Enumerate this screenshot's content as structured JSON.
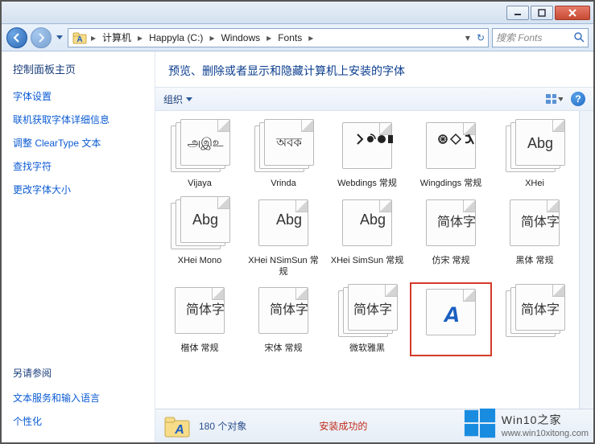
{
  "titlebar": {
    "min": "—",
    "max": "□",
    "close": "×"
  },
  "breadcrumb": {
    "segs": [
      "计算机",
      "Happyla (C:)",
      "Windows",
      "Fonts"
    ]
  },
  "search": {
    "placeholder": "搜索 Fonts"
  },
  "sidebar": {
    "heading": "控制面板主页",
    "links": [
      "字体设置",
      "联机获取字体详细信息",
      "调整 ClearType 文本",
      "查找字符",
      "更改字体大小"
    ],
    "see_also": "另请参阅",
    "sa_links": [
      "文本服务和输入语言",
      "个性化"
    ]
  },
  "page": {
    "title": "预览、删除或者显示和隐藏计算机上安装的字体",
    "organize": "组织"
  },
  "fonts": [
    {
      "label": "Vijaya",
      "sample": "அஇஉ",
      "stack": true,
      "cls": ""
    },
    {
      "label": "Vrinda",
      "sample": "অবক",
      "stack": true,
      "cls": ""
    },
    {
      "label": "Webdings 常规",
      "sample": "svg-web",
      "stack": false,
      "cls": ""
    },
    {
      "label": "Wingdings 常规",
      "sample": "svg-wing",
      "stack": false,
      "cls": ""
    },
    {
      "label": "XHei",
      "sample": "Abg",
      "stack": true,
      "cls": "big"
    },
    {
      "label": "XHei Mono",
      "sample": "Abg",
      "stack": true,
      "cls": "big"
    },
    {
      "label": "XHei NSimSun 常规",
      "sample": "Abg",
      "stack": false,
      "cls": "big"
    },
    {
      "label": "XHei SimSun 常规",
      "sample": "Abg",
      "stack": false,
      "cls": "big"
    },
    {
      "label": "仿宋 常规",
      "sample": "简体字",
      "stack": false,
      "cls": "cn"
    },
    {
      "label": "黑体 常规",
      "sample": "简体字",
      "stack": false,
      "cls": "cn"
    },
    {
      "label": "楷体 常规",
      "sample": "简体字",
      "stack": false,
      "cls": "cn"
    },
    {
      "label": "宋体 常规",
      "sample": "简体字",
      "stack": false,
      "cls": "cn"
    },
    {
      "label": "微软雅黑",
      "sample": "简体字",
      "stack": true,
      "cls": "cn"
    },
    {
      "label": "",
      "sample": "svg-sel",
      "stack": false,
      "cls": "",
      "selected": true
    },
    {
      "label": "",
      "sample": "简体字",
      "stack": true,
      "cls": "cn"
    }
  ],
  "status": {
    "count": "180 个对象",
    "red": "安装成功的"
  },
  "watermark": {
    "big": "Win10",
    "suffix": "之家",
    "url": "www.win10xitong.com"
  }
}
